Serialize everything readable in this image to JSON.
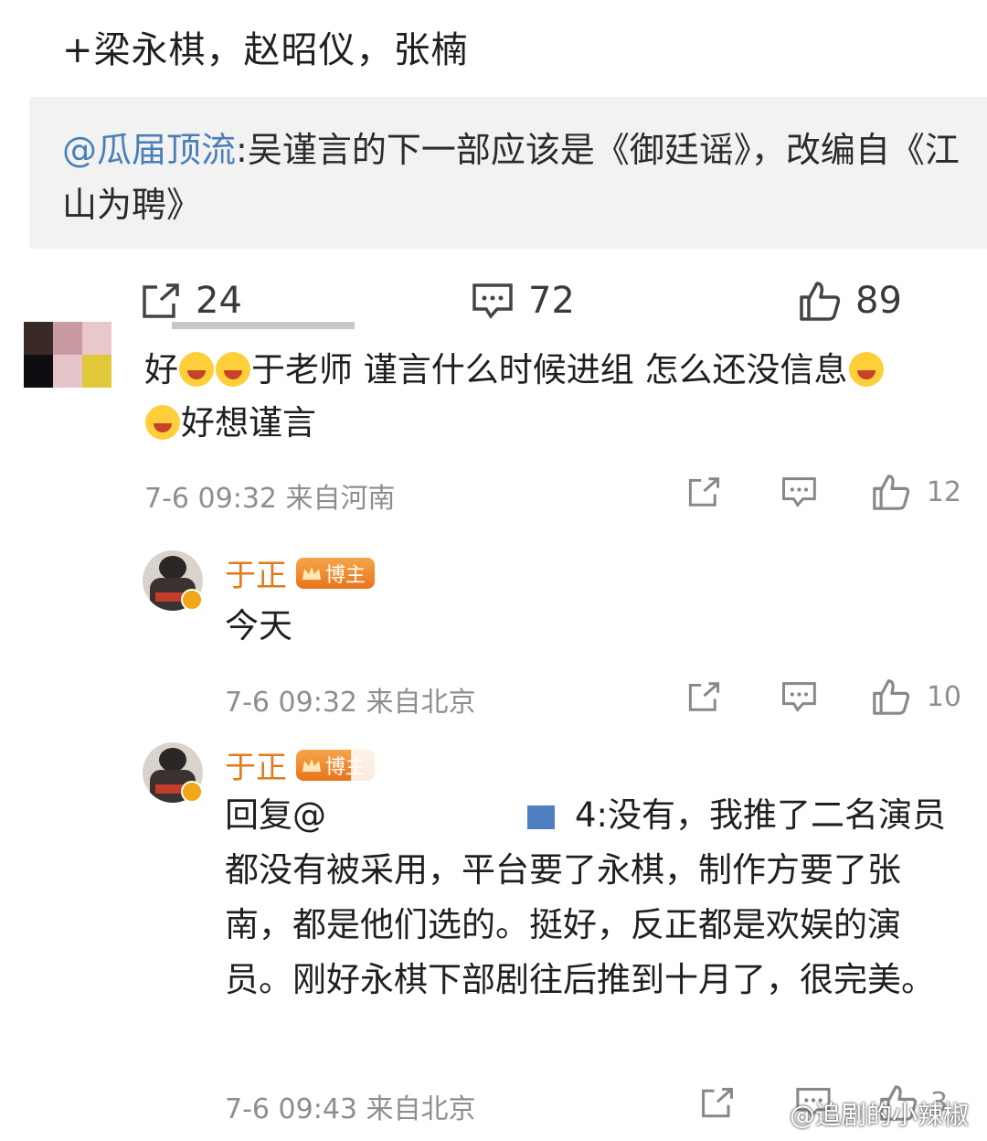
{
  "post": {
    "text": "+梁永棋，赵昭仪，张楠",
    "quote_mention": "@瓜届顶流",
    "quote_text": ":吴谨言的下一部应该是《御廷谣》，改编自《江山为聘》",
    "repost_count": "24",
    "comment_count": "72",
    "like_count": "89"
  },
  "comments": [
    {
      "text_a": "好",
      "text_b": "于老师 谨言什么时候进组 怎么还没信息",
      "text_c": "好想谨言",
      "time": "7-6 09:32 来自河南",
      "likes": "12"
    }
  ],
  "replies": [
    {
      "user": "于正",
      "badge": "博主",
      "text": "今天",
      "time": "7-6 09:32 来自北京",
      "likes": "10"
    },
    {
      "user": "于正",
      "badge": "博主",
      "reply_prefix": "回复@",
      "reply_suffix": "4:",
      "text": "没有，我推了二名演员都没有被采用，平台要了永棋，制作方要了张南，都是他们选的。挺好，反正都是欢娱的演员。刚好永棋下部剧往后推到十月了，很完美。",
      "time": "7-6 09:43 来自北京",
      "likes": "3"
    }
  ],
  "watermark": "@追剧的小辣椒",
  "colors": {
    "mention": "#4a7fb5",
    "username": "#e07a1c",
    "badge": "#f0901f",
    "meta": "#8e8e8e"
  }
}
